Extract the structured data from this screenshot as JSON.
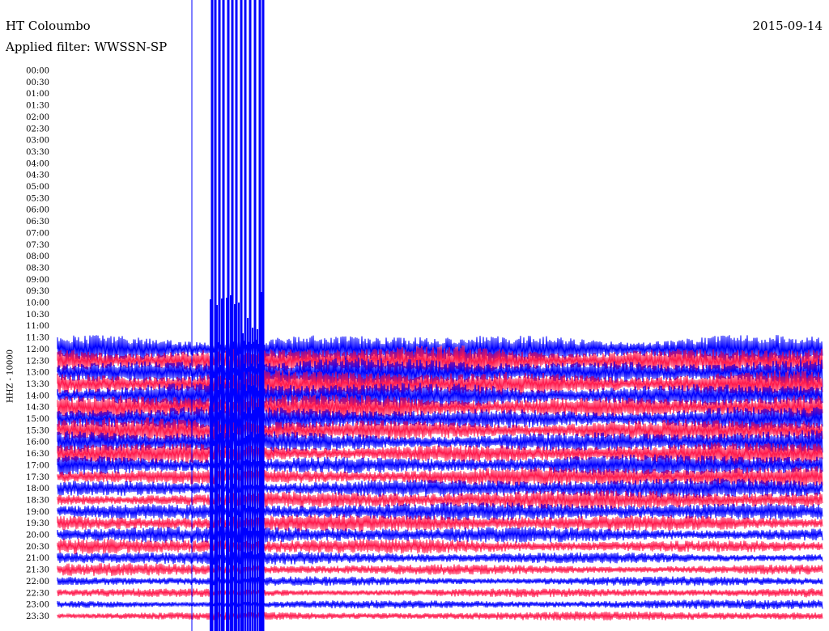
{
  "header": {
    "station": "HT Coloumbo",
    "filter": "Applied filter: WWSSN-SP",
    "date": "2015-09-14"
  },
  "chart_data": {
    "type": "line",
    "ylabel": "HHZ - 10000",
    "row_times": [
      "00:00",
      "00:30",
      "01:00",
      "01:30",
      "02:00",
      "02:30",
      "03:00",
      "03:30",
      "04:00",
      "04:30",
      "05:00",
      "05:30",
      "06:00",
      "06:30",
      "07:00",
      "07:30",
      "08:00",
      "08:30",
      "09:00",
      "09:30",
      "10:00",
      "10:30",
      "11:00",
      "11:30",
      "12:00",
      "12:30",
      "13:00",
      "13:30",
      "14:00",
      "14:30",
      "15:00",
      "15:30",
      "16:00",
      "16:30",
      "17:00",
      "17:30",
      "18:00",
      "18:30",
      "19:00",
      "19:30",
      "20:00",
      "20:30",
      "21:00",
      "21:30",
      "22:00",
      "22:30",
      "23:00",
      "23:30"
    ],
    "first_data_row": "12:00",
    "series_colors": [
      "#0000ff",
      "#ff1a4d"
    ],
    "grid": false
  }
}
